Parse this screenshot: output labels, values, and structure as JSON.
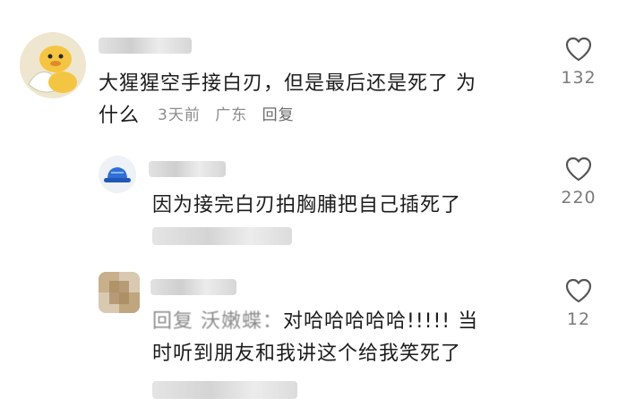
{
  "comments": [
    {
      "text_line1": "大猩猩空手接白刃，但是最后还是死了 为",
      "text_line2": "什么",
      "time": "3天前",
      "location": "广东",
      "reply_label": "回复",
      "likes": "132",
      "avatar_icon": "duck-avatar-icon"
    }
  ],
  "replies": [
    {
      "text": "因为接完白刃拍胸脯把自己插死了",
      "likes": "220",
      "avatar_icon": "blue-hat-avatar-icon"
    },
    {
      "prefix": "回复 沃嫩蝶：",
      "text_line1": "对哈哈哈哈哈!!!!!  当",
      "text_line2": "时听到朋友和我讲这个给我笑死了",
      "likes": "12",
      "avatar_icon": "blurred-avatar-icon"
    }
  ],
  "colors": {
    "text": "#1c1c1c",
    "meta": "#8c8c8c",
    "icon": "#555555"
  }
}
